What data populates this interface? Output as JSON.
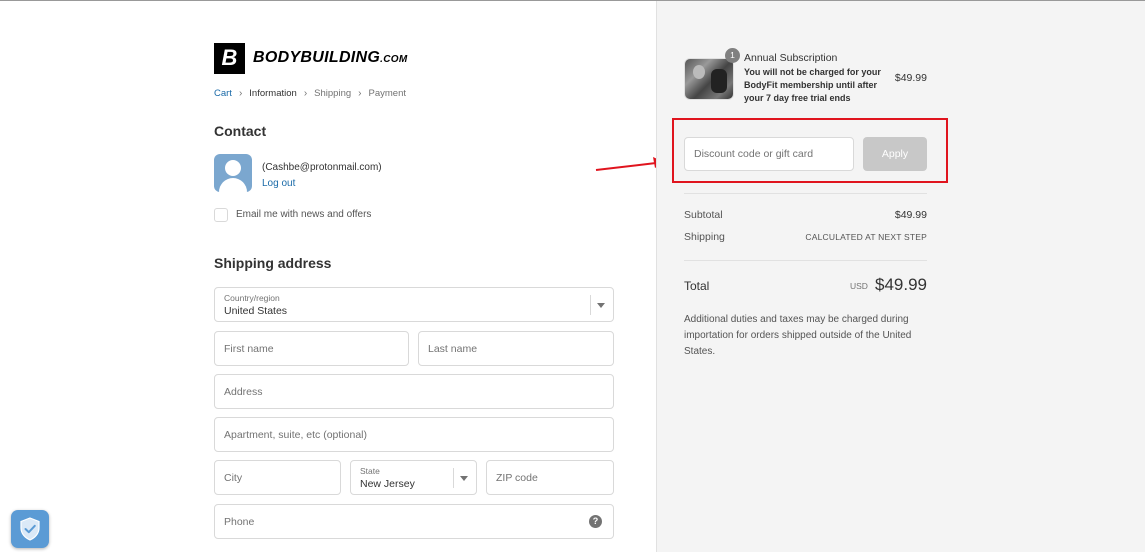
{
  "brand": {
    "logo_mark": "B",
    "logo_text": "BODYBUILDING",
    "logo_suffix": ".COM"
  },
  "breadcrumb": [
    {
      "label": "Cart",
      "state": "link"
    },
    {
      "label": "Information",
      "state": "current"
    },
    {
      "label": "Shipping",
      "state": "inactive"
    },
    {
      "label": "Payment",
      "state": "inactive"
    }
  ],
  "breadcrumb_separator": "›",
  "contact": {
    "title": "Contact",
    "email": "(Cashbe@protonmail.com)",
    "logout_label": "Log out",
    "newsletter_label": "Email me with news and offers"
  },
  "shipping": {
    "title": "Shipping address",
    "country_label": "Country/region",
    "country_value": "United States",
    "first_name_placeholder": "First name",
    "last_name_placeholder": "Last name",
    "address_placeholder": "Address",
    "apartment_placeholder": "Apartment, suite, etc (optional)",
    "city_placeholder": "City",
    "state_label": "State",
    "state_value": "New Jersey",
    "zip_placeholder": "ZIP code",
    "phone_placeholder": "Phone",
    "help_glyph": "?"
  },
  "order": {
    "quantity": "1",
    "product_name": "Annual Subscription",
    "product_description": "You will not be charged for your BodyFit membership until after your 7 day free trial ends",
    "product_price": "$49.99",
    "discount_placeholder": "Discount code or gift card",
    "apply_label": "Apply",
    "subtotal_label": "Subtotal",
    "subtotal_value": "$49.99",
    "shipping_label": "Shipping",
    "shipping_value": "CALCULATED AT NEXT STEP",
    "total_label": "Total",
    "currency": "USD",
    "total_value": "$49.99",
    "note": "Additional duties and taxes may be charged during importation for orders shipped outside of the United States."
  },
  "colors": {
    "link": "#1a6aa8",
    "annotation_red": "#e0141e",
    "apply_disabled": "#c8c8c8",
    "sidebar_bg": "#f4f4f4"
  },
  "icons": {
    "avatar": "user-avatar-icon",
    "help": "question-circle-icon",
    "shield": "shield-check-icon",
    "caret": "caret-down-icon",
    "arrow": "red-arrow-icon"
  }
}
